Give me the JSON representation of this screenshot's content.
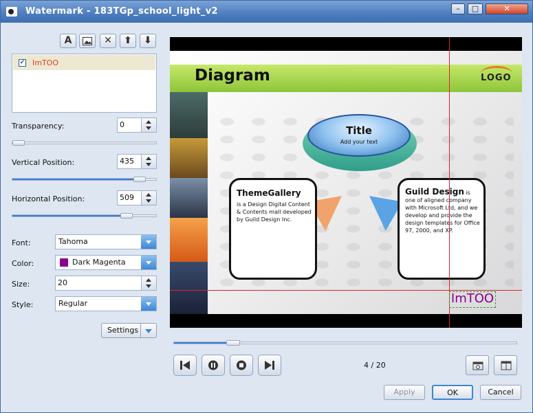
{
  "window": {
    "title": "Watermark - 183TGp_school_light_v2",
    "minimize_icon": "minimize-icon",
    "maximize_icon": "maximize-icon",
    "close_icon": "close-icon"
  },
  "toolbar": [
    {
      "name": "add-text-watermark-button",
      "glyph": "A"
    },
    {
      "name": "add-image-watermark-button",
      "glyph": "▣"
    },
    {
      "name": "delete-watermark-button",
      "glyph": "✕"
    },
    {
      "name": "move-up-button",
      "glyph": "⬆"
    },
    {
      "name": "move-down-button",
      "glyph": "⬇"
    }
  ],
  "watermark_list": {
    "items": [
      {
        "label": "ImTOO",
        "checked": true
      }
    ]
  },
  "transparency": {
    "label": "Transparency:",
    "value": "0",
    "fraction": 0.0
  },
  "vertical_position": {
    "label": "Vertical Position:",
    "value": "435",
    "fraction": 0.92
  },
  "horizontal_position": {
    "label": "Horizontal Position:",
    "value": "509",
    "fraction": 0.82
  },
  "font": {
    "label": "Font:",
    "value": "Tahoma"
  },
  "color": {
    "label": "Color:",
    "value": "Dark Magenta",
    "swatch": "#8b008b"
  },
  "size": {
    "label": "Size:",
    "value": "20"
  },
  "style": {
    "label": "Style:",
    "value": "Regular"
  },
  "settings_button": "Settings",
  "slide": {
    "title": "Diagram",
    "logo": "LOGO",
    "center_title": "Title",
    "center_sub": "Add your text",
    "left_card_title": "ThemeGallery",
    "left_card_body": "is a Design Digital Content & Contents mall developed by Guild Design Inc.",
    "right_card_title": "Guild Design",
    "right_card_body_suffix": " is one of aligned company with Microsoft Ltd, and we develop and provide the design templates for Office 97, 2000, and XP.",
    "watermark_text": "ImTOO"
  },
  "playback": {
    "progress_fraction": 0.16,
    "page_counter": "4 / 20",
    "first_icon": "skip-back-icon",
    "pause_icon": "pause-icon",
    "stop_icon": "stop-icon",
    "last_icon": "skip-forward-icon"
  },
  "footer": {
    "apply": "Apply",
    "ok": "OK",
    "cancel": "Cancel"
  }
}
